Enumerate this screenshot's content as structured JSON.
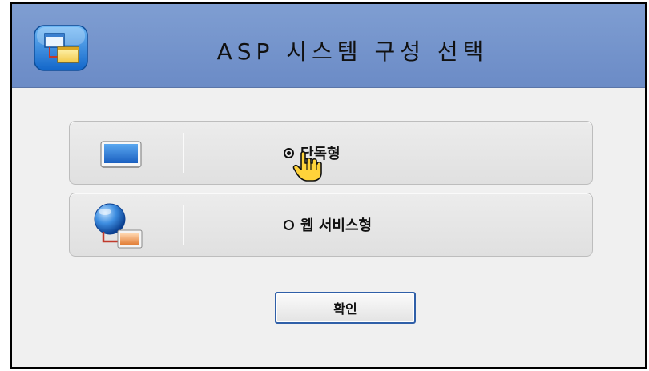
{
  "dialog": {
    "title": "ASP 시스템 구성 선택",
    "title_icon": "app-window-icon"
  },
  "options": [
    {
      "label": "단독형",
      "icon": "monitor-icon",
      "selected": true
    },
    {
      "label": "웹 서비스형",
      "icon": "web-service-icon",
      "selected": false
    }
  ],
  "confirm": {
    "label": "확인"
  },
  "colors": {
    "titlebar": "#7594cc",
    "panel": "#e6e6e6",
    "button_border": "#2f5fa8"
  }
}
